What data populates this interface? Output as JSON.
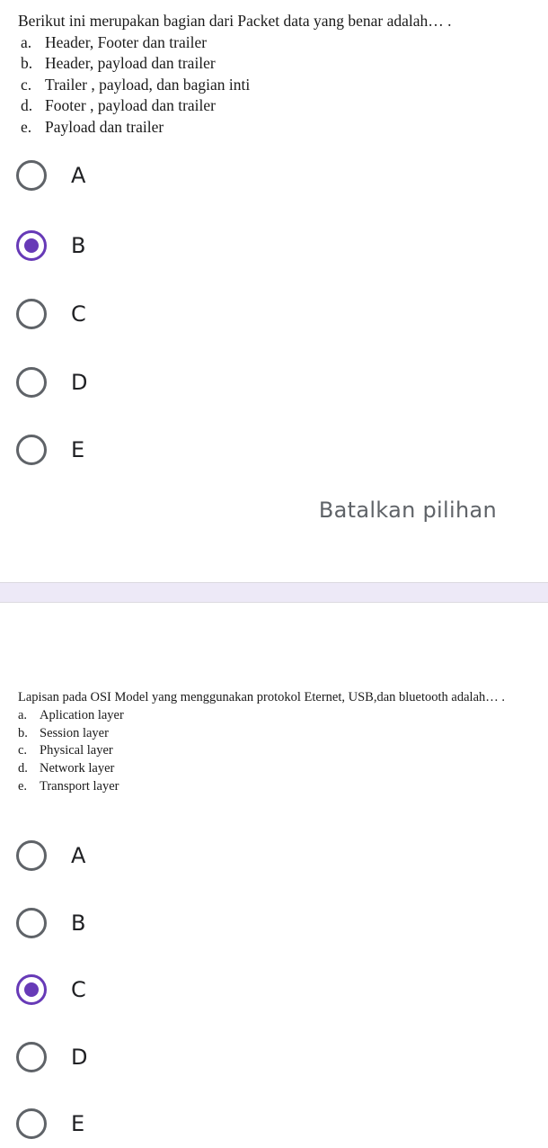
{
  "question1": {
    "prompt": "Berikut ini merupakan bagian dari Packet data yang benar adalah… .",
    "options": [
      {
        "letter": "a.",
        "text": "Header, Footer dan trailer"
      },
      {
        "letter": "b.",
        "text": "Header, payload dan trailer"
      },
      {
        "letter": "c.",
        "text": "Trailer , payload, dan bagian inti"
      },
      {
        "letter": "d.",
        "text": "Footer , payload dan trailer"
      },
      {
        "letter": "e.",
        "text": "Payload dan trailer"
      }
    ],
    "choices": [
      {
        "label": "A",
        "selected": false
      },
      {
        "label": "B",
        "selected": true
      },
      {
        "label": "C",
        "selected": false
      },
      {
        "label": "D",
        "selected": false
      },
      {
        "label": "E",
        "selected": false
      }
    ],
    "clear_label": "Batalkan pilihan"
  },
  "question2": {
    "prompt": "Lapisan pada OSI Model yang menggunakan protokol Eternet, USB,dan bluetooth adalah… .",
    "options": [
      {
        "letter": "a.",
        "text": "Aplication layer"
      },
      {
        "letter": "b.",
        "text": "Session layer"
      },
      {
        "letter": "c.",
        "text": "Physical layer"
      },
      {
        "letter": "d.",
        "text": "Network layer"
      },
      {
        "letter": "e.",
        "text": "Transport layer"
      }
    ],
    "choices": [
      {
        "label": "A",
        "selected": false
      },
      {
        "label": "B",
        "selected": false
      },
      {
        "label": "C",
        "selected": true
      },
      {
        "label": "D",
        "selected": false
      },
      {
        "label": "E",
        "selected": false
      }
    ]
  },
  "colors": {
    "accent": "#673ab7",
    "band": "#ede9f7",
    "radio_unchecked": "#5f6368"
  }
}
